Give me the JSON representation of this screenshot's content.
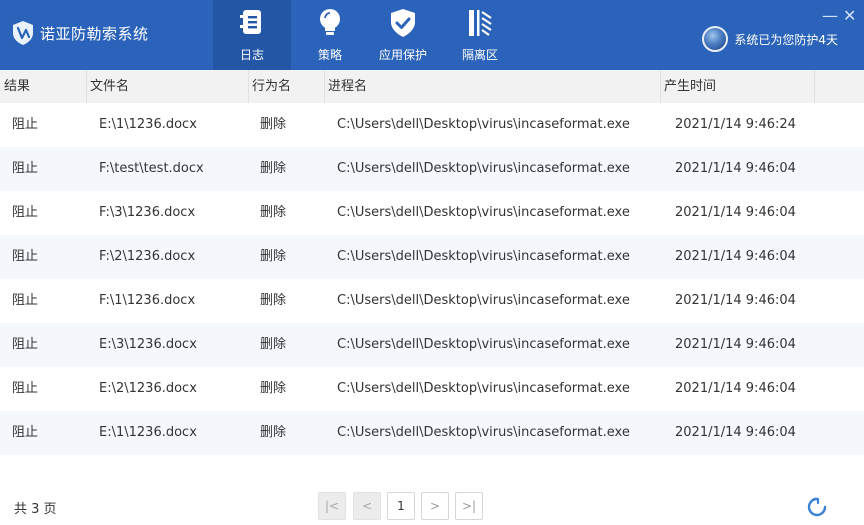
{
  "app": {
    "title": "诺亚防勒索系统",
    "status_text": "系统已为您防护4天",
    "minimize": "—",
    "close": "✕"
  },
  "nav": [
    {
      "label": "日志",
      "icon": "log-icon",
      "active": true
    },
    {
      "label": "策略",
      "icon": "lightbulb-icon",
      "active": false
    },
    {
      "label": "应用保护",
      "icon": "shield-check-icon",
      "active": false
    },
    {
      "label": "隔离区",
      "icon": "isolation-icon",
      "active": false
    }
  ],
  "table": {
    "columns": [
      "结果",
      "文件名",
      "行为名",
      "进程名",
      "产生时间"
    ],
    "rows": [
      {
        "result": "阻止",
        "file": "E:\\1\\1236.docx",
        "action": "删除",
        "process": "C:\\Users\\dell\\Desktop\\virus\\incaseformat.exe",
        "time": "2021/1/14 9:46:24"
      },
      {
        "result": "阻止",
        "file": "F:\\test\\test.docx",
        "action": "删除",
        "process": "C:\\Users\\dell\\Desktop\\virus\\incaseformat.exe",
        "time": "2021/1/14 9:46:04"
      },
      {
        "result": "阻止",
        "file": "F:\\3\\1236.docx",
        "action": "删除",
        "process": "C:\\Users\\dell\\Desktop\\virus\\incaseformat.exe",
        "time": "2021/1/14 9:46:04"
      },
      {
        "result": "阻止",
        "file": "F:\\2\\1236.docx",
        "action": "删除",
        "process": "C:\\Users\\dell\\Desktop\\virus\\incaseformat.exe",
        "time": "2021/1/14 9:46:04"
      },
      {
        "result": "阻止",
        "file": "F:\\1\\1236.docx",
        "action": "删除",
        "process": "C:\\Users\\dell\\Desktop\\virus\\incaseformat.exe",
        "time": "2021/1/14 9:46:04"
      },
      {
        "result": "阻止",
        "file": "E:\\3\\1236.docx",
        "action": "删除",
        "process": "C:\\Users\\dell\\Desktop\\virus\\incaseformat.exe",
        "time": "2021/1/14 9:46:04"
      },
      {
        "result": "阻止",
        "file": "E:\\2\\1236.docx",
        "action": "删除",
        "process": "C:\\Users\\dell\\Desktop\\virus\\incaseformat.exe",
        "time": "2021/1/14 9:46:04"
      },
      {
        "result": "阻止",
        "file": "E:\\1\\1236.docx",
        "action": "删除",
        "process": "C:\\Users\\dell\\Desktop\\virus\\incaseformat.exe",
        "time": "2021/1/14 9:46:04"
      }
    ]
  },
  "footer": {
    "total_pages": "共 3 页",
    "current_page": "1",
    "first": "|<",
    "prev": "<",
    "next": ">",
    "last": ">|"
  },
  "colors": {
    "header_bg": "#2a63b9",
    "active_tab_bg": "#2456a6",
    "row_alt_bg": "#f4f8fd",
    "refresh_icon": "#3b82d6"
  }
}
